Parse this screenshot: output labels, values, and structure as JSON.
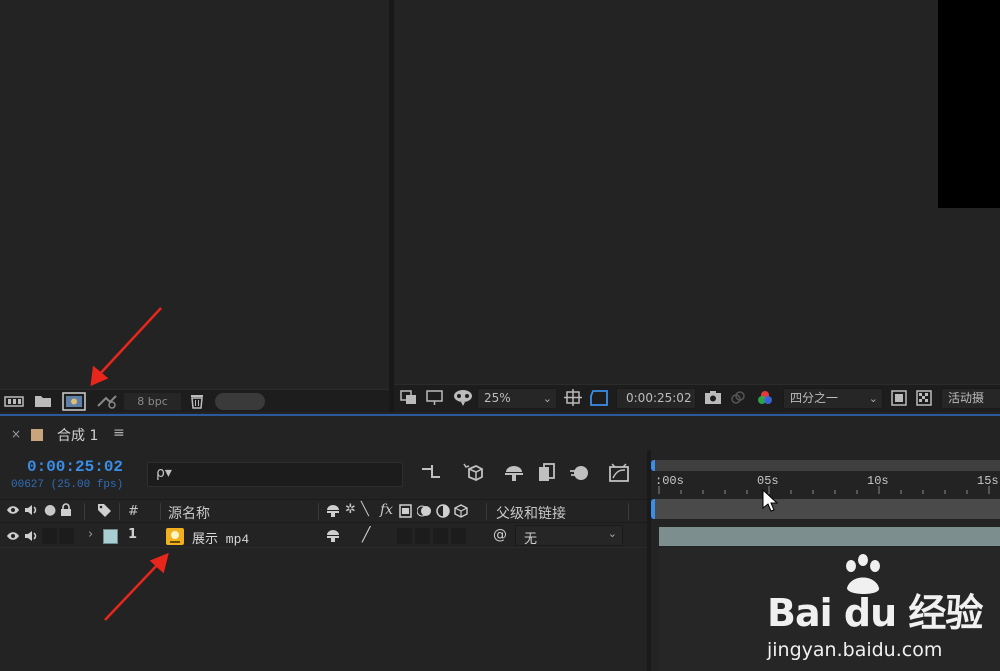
{
  "project_toolbar": {
    "bpc_label": "8 bpc",
    "icons": [
      "interpret-footage-icon",
      "new-folder-icon",
      "new-composition-icon",
      "flowchart-icon",
      "trash-icon"
    ]
  },
  "viewer_toolbar": {
    "zoom": "25%",
    "timecode": "0:00:25:02",
    "resolution": "四分之一",
    "camera": "活动摄"
  },
  "timeline": {
    "tab_title": "合成 1",
    "timecode": "0:00:25:02",
    "frames": "00627 (25.00 fps)",
    "search_placeholder": "ρ▾",
    "headers": {
      "number": "#",
      "source_name": "源名称",
      "parent": "父级和链接"
    },
    "layers": [
      {
        "index": "1",
        "name": "展示 mp4",
        "parent": "无",
        "label_color": "#a9cfd3"
      }
    ],
    "ruler_labels": [
      ":00s",
      "05s",
      "10s",
      "15s"
    ]
  },
  "watermark": {
    "logo": "Bai du 经验",
    "site": "jingyan.baidu.com"
  },
  "colors": {
    "accent": "#3b8ee8",
    "annotation": "#e8261c",
    "tab_swatch": "#c8a57c"
  }
}
